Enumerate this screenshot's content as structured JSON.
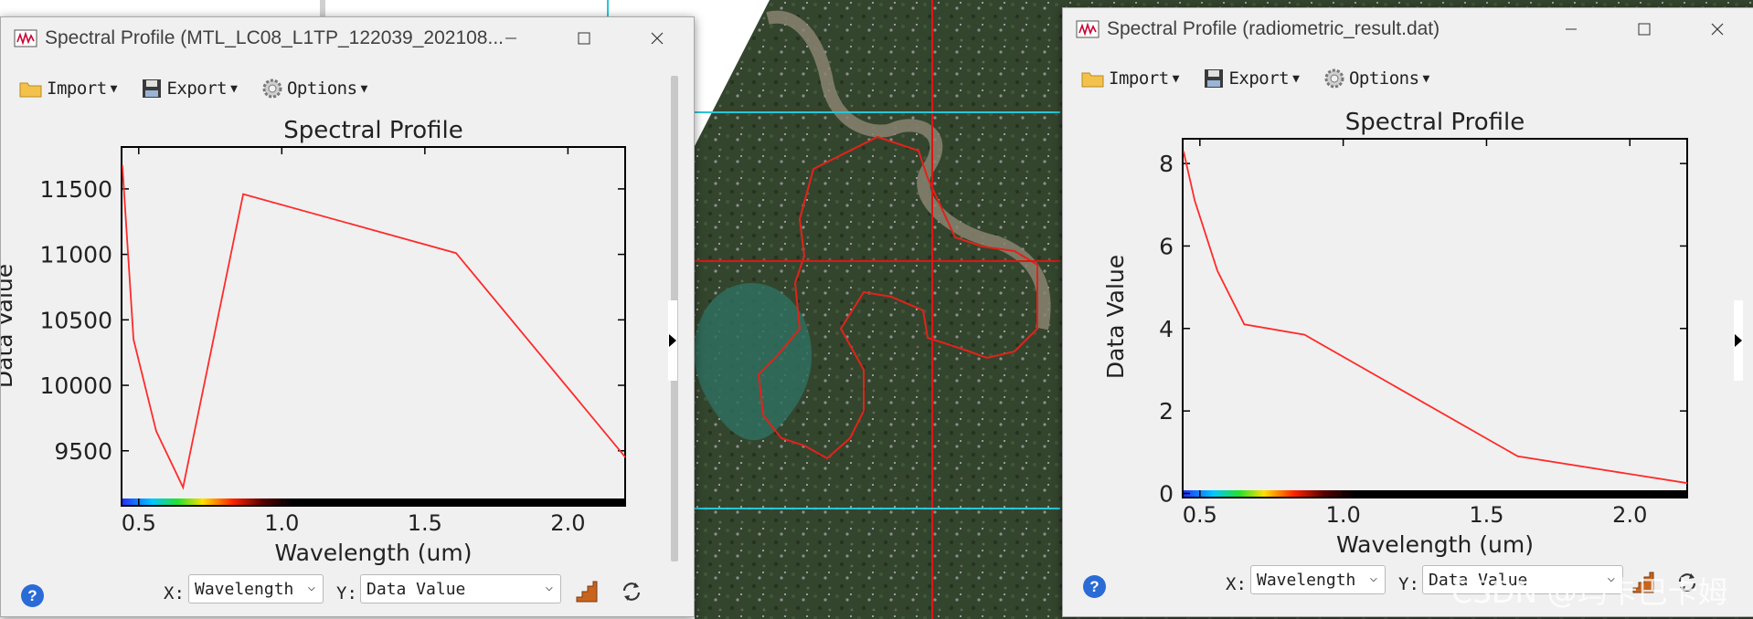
{
  "background": {
    "name": "satellite-image-view"
  },
  "windows": [
    {
      "title": "Spectral Profile (MTL_LC08_L1TP_122039_202108...",
      "toolbar": {
        "import": "Import",
        "export": "Export",
        "options": "Options"
      },
      "footer": {
        "x_label": "X:",
        "x_value": "Wavelength",
        "y_label": "Y:",
        "y_value": "Data Value",
        "help": "?"
      }
    },
    {
      "title": "Spectral Profile (radiometric_result.dat)",
      "toolbar": {
        "import": "Import",
        "export": "Export",
        "options": "Options"
      },
      "footer": {
        "x_label": "X:",
        "x_value": "Wavelength",
        "y_label": "Y:",
        "y_value": "Data Value",
        "help": "?"
      }
    }
  ],
  "chart_data": [
    {
      "type": "line",
      "title": "Spectral Profile",
      "xlabel": "Wavelength (um)",
      "ylabel": "Data Value",
      "xlim": [
        0.44,
        2.2
      ],
      "ylim": [
        9080,
        11820
      ],
      "x_ticks": [
        "0.5",
        "1.0",
        "1.5",
        "2.0"
      ],
      "y_ticks": [
        "9500",
        "10000",
        "10500",
        "11000",
        "11500"
      ],
      "series": [
        {
          "color": "#ff2a2a",
          "x": [
            0.443,
            0.482,
            0.561,
            0.655,
            0.865,
            1.609,
            2.201
          ],
          "y": [
            11680,
            10350,
            9650,
            9220,
            11460,
            11010,
            9450
          ]
        }
      ]
    },
    {
      "type": "line",
      "title": "Spectral Profile",
      "xlabel": "Wavelength (um)",
      "ylabel": "Data Value",
      "xlim": [
        0.44,
        2.2
      ],
      "ylim": [
        -0.1,
        8.6
      ],
      "x_ticks": [
        "0.5",
        "1.0",
        "1.5",
        "2.0"
      ],
      "y_ticks": [
        "0",
        "2",
        "4",
        "6",
        "8"
      ],
      "series": [
        {
          "color": "#ff2a2a",
          "x": [
            0.443,
            0.482,
            0.561,
            0.655,
            0.865,
            1.609,
            2.201
          ],
          "y": [
            8.3,
            7.1,
            5.4,
            4.1,
            3.85,
            0.9,
            0.25
          ]
        }
      ]
    }
  ],
  "watermark": "CSDN @玛卡巴卡姆"
}
